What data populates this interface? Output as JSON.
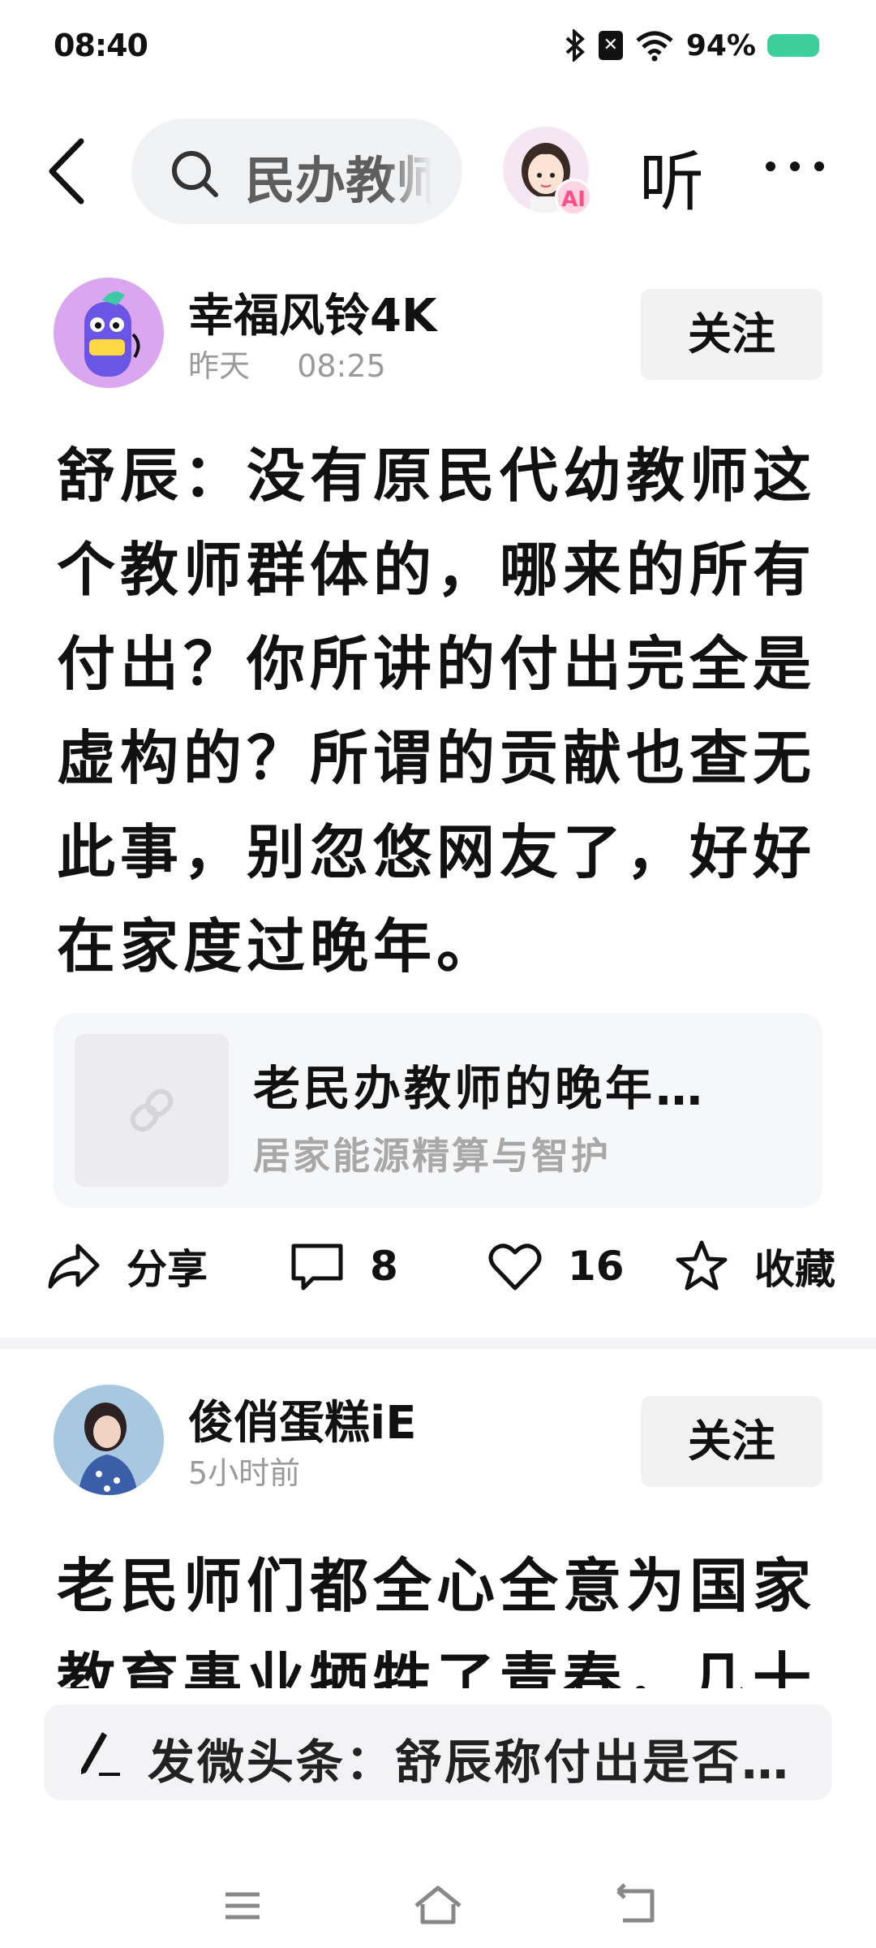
{
  "status_bar": {
    "time": "08:40",
    "battery": "94%",
    "icons": [
      "bluetooth-icon",
      "no-sim-icon",
      "wifi-icon",
      "battery-icon"
    ],
    "battery_color": "#3ccf9b"
  },
  "top_nav": {
    "search_text": "民办教师",
    "ai_badge": "AI",
    "listen_label": "听"
  },
  "posts": [
    {
      "author": "幸福风铃4K",
      "date": "昨天",
      "time": "08:25",
      "follow_label": "关注",
      "text": "舒辰：没有原民代幼教师这个教师群体的，哪来的所有付出？你所讲的付出完全是虚构的？所谓的贡献也查无此事，别忽悠网友了，好好在家度过晚年。",
      "link_card": {
        "title": "老民办教师的晚年…",
        "subtitle": "居家能源精算与智护"
      },
      "actions": {
        "share_label": "分享",
        "comments": "8",
        "likes": "16",
        "favorite_label": "收藏"
      }
    },
    {
      "author": "俊俏蛋糕iE",
      "time": "5小时前",
      "follow_label": "关注",
      "text": "老民师们都全心全意为国家教育事业牺牲了青春，几十"
    }
  ],
  "comment_bar": {
    "placeholder": "发微头条：舒辰称付出是否…"
  },
  "colors": {
    "accent_green": "#3ccf9b",
    "follow_bg": "#f2f2f2",
    "card_bg": "#f6f7f9"
  }
}
